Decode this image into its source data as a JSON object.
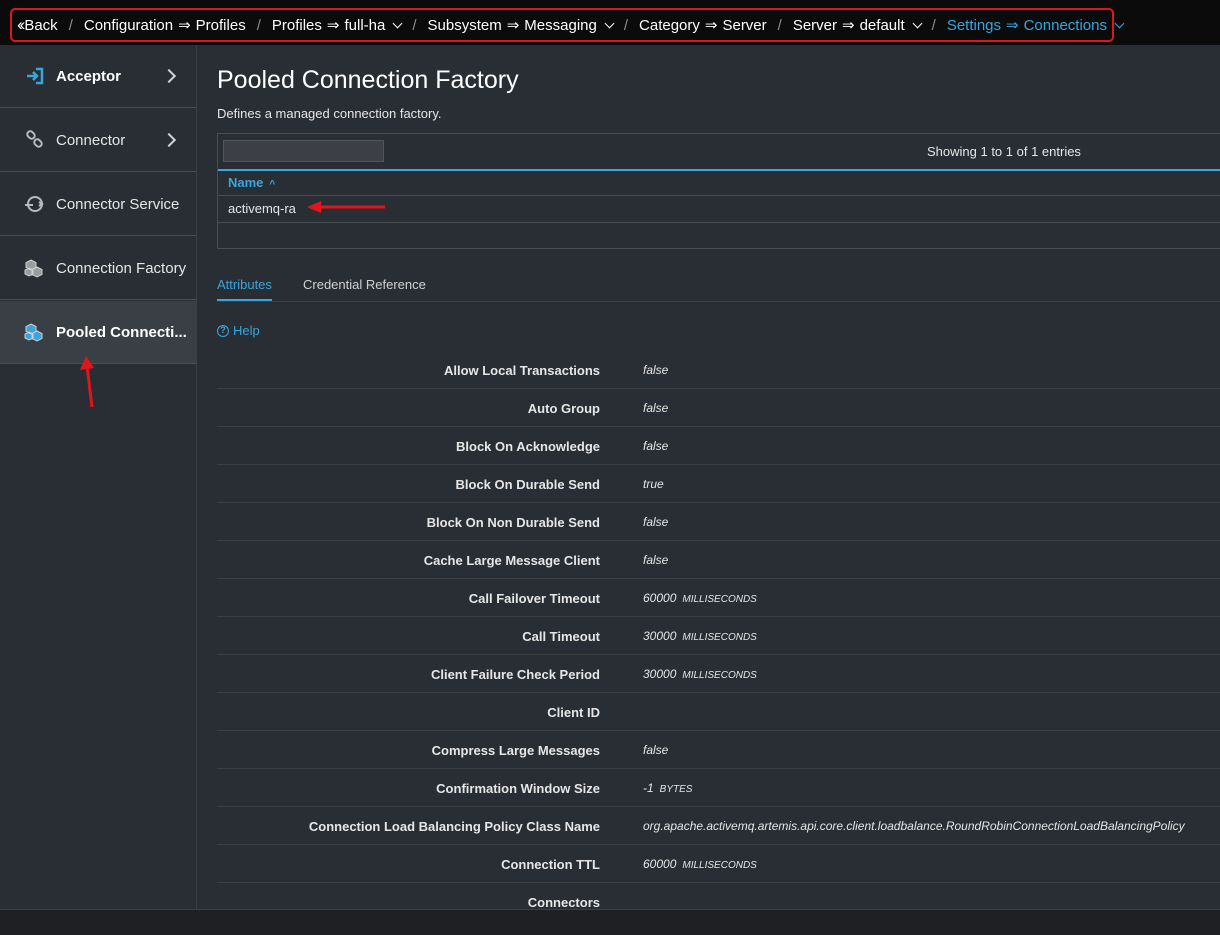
{
  "breadcrumb": {
    "back_label": "Back",
    "items": [
      {
        "parent": "Configuration",
        "child": "Profiles",
        "dropdown": false
      },
      {
        "parent": "Profiles",
        "child": "full-ha",
        "dropdown": true
      },
      {
        "parent": "Subsystem",
        "child": "Messaging",
        "dropdown": true
      },
      {
        "parent": "Category",
        "child": "Server",
        "dropdown": false
      },
      {
        "parent": "Server",
        "child": "default",
        "dropdown": true
      },
      {
        "parent": "Settings",
        "child": "Connections",
        "dropdown": true
      }
    ],
    "arrow": "⇒",
    "separator": "/"
  },
  "sidebar": {
    "items": [
      {
        "label": "Acceptor",
        "icon": "sign-in-icon"
      },
      {
        "label": "Connector",
        "icon": "link-icon"
      },
      {
        "label": "Connector Service",
        "icon": "plug-icon"
      },
      {
        "label": "Connection Factory",
        "icon": "cubes-icon"
      },
      {
        "label": "Pooled Connecti...",
        "icon": "cubes-icon"
      }
    ]
  },
  "page": {
    "title": "Pooled Connection Factory",
    "description": "Defines a managed connection factory.",
    "showing": "Showing 1 to 1 of 1 entries",
    "name_header": "Name",
    "sort_caret": "^",
    "rows": [
      "activemq-ra"
    ]
  },
  "tabs": [
    "Attributes",
    "Credential Reference"
  ],
  "help_label": "Help",
  "attributes": [
    {
      "label": "Allow Local Transactions",
      "value": "false",
      "unit": ""
    },
    {
      "label": "Auto Group",
      "value": "false",
      "unit": ""
    },
    {
      "label": "Block On Acknowledge",
      "value": "false",
      "unit": ""
    },
    {
      "label": "Block On Durable Send",
      "value": "true",
      "unit": ""
    },
    {
      "label": "Block On Non Durable Send",
      "value": "false",
      "unit": ""
    },
    {
      "label": "Cache Large Message Client",
      "value": "false",
      "unit": ""
    },
    {
      "label": "Call Failover Timeout",
      "value": "60000",
      "unit": "MILLISECONDS"
    },
    {
      "label": "Call Timeout",
      "value": "30000",
      "unit": "MILLISECONDS"
    },
    {
      "label": "Client Failure Check Period",
      "value": "30000",
      "unit": "MILLISECONDS"
    },
    {
      "label": "Client ID",
      "value": "",
      "unit": ""
    },
    {
      "label": "Compress Large Messages",
      "value": "false",
      "unit": ""
    },
    {
      "label": "Confirmation Window Size",
      "value": "-1",
      "unit": "BYTES"
    },
    {
      "label": "Connection Load Balancing Policy Class Name",
      "value": "org.apache.activemq.artemis.api.core.client.loadbalance.RoundRobinConnectionLoadBalancingPolicy",
      "unit": ""
    },
    {
      "label": "Connection TTL",
      "value": "60000",
      "unit": "MILLISECONDS"
    },
    {
      "label": "Connectors",
      "value": "",
      "unit": ""
    }
  ],
  "colors": {
    "accent": "#39a5dc",
    "annotation_red": "#e0161c",
    "panel": "#292e34"
  }
}
